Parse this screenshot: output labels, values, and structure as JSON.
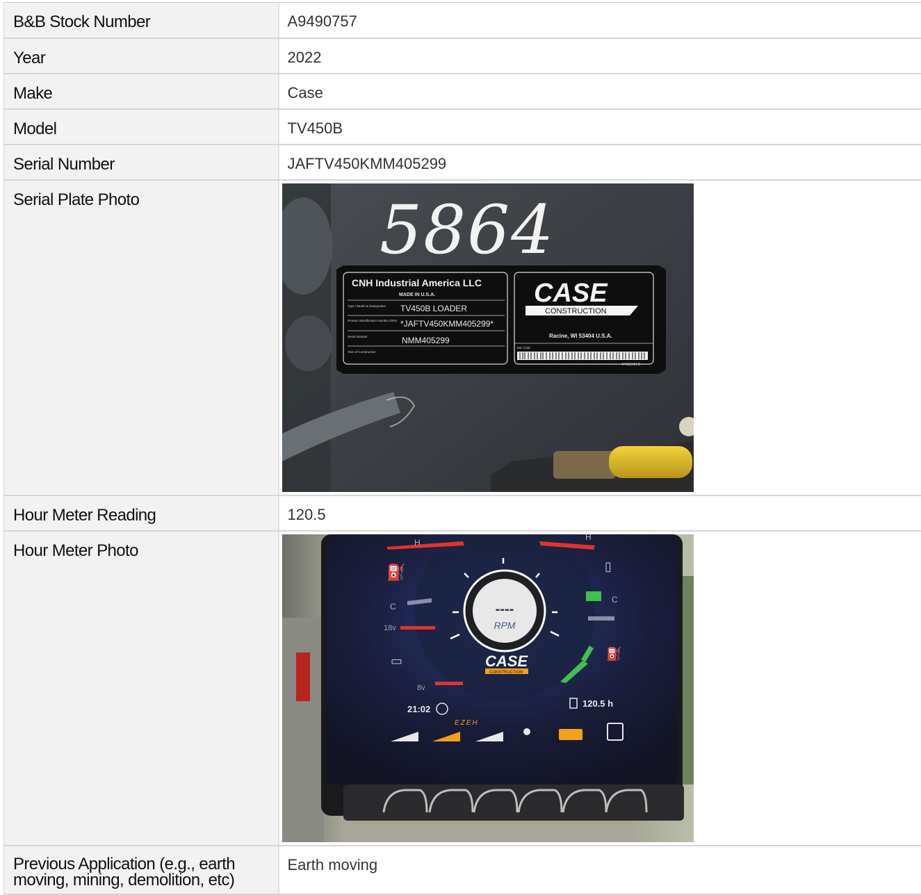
{
  "rows": [
    {
      "label": "B&B Stock Number",
      "value": "A9490757"
    },
    {
      "label": "Year",
      "value": "2022"
    },
    {
      "label": "Make",
      "value": "Case"
    },
    {
      "label": "Model",
      "value": "TV450B"
    },
    {
      "label": "Serial Number",
      "value": "JAFTV450KMM405299"
    },
    {
      "label": "Serial Plate Photo"
    },
    {
      "label": "Hour Meter Reading",
      "value": "120.5"
    },
    {
      "label": "Hour Meter Photo"
    },
    {
      "label_line1": "Previous Application (e.g., earth",
      "label_line2": "moving, mining, demolition, etc)",
      "value": "Earth moving"
    }
  ],
  "serial_plate": {
    "handwritten": "5864",
    "company": "CNH Industrial America LLC",
    "made_in": "MADE IN U.S.A.",
    "field_labels": [
      "Type / Model & Designation",
      "Product Identification Number (PIN)",
      "Serial Number",
      "Year of Construction"
    ],
    "model_designation": "TV450B LOADER",
    "pin": "*JAFTV450KMM405299*",
    "serial": "NMM405299",
    "brand": "CASE",
    "brand_sub": "CONSTRUCTION",
    "address": "Racine, WI 53404 U.S.A.",
    "bar_code_label": "Bar Code",
    "part_no": "47481949 D"
  },
  "hour_meter": {
    "rpm_value": "----",
    "rpm_label": "RPM",
    "brand": "CASE",
    "brand_sub": "CONSTRUCTION",
    "hours": "120.5 h",
    "clock": "21:02",
    "mode": "EZEH",
    "temp_high": "H",
    "temp_cold": "C",
    "volt_high": "18v",
    "volt_low": "8v",
    "fuel_high": "H",
    "fuel_cold": "C"
  },
  "colors": {
    "label_bg": "#f2f2f2",
    "border": "#d6d6d6",
    "case_orange": "#f5a01a",
    "screen_green": "#3ec24a",
    "screen_red": "#e0352b"
  }
}
